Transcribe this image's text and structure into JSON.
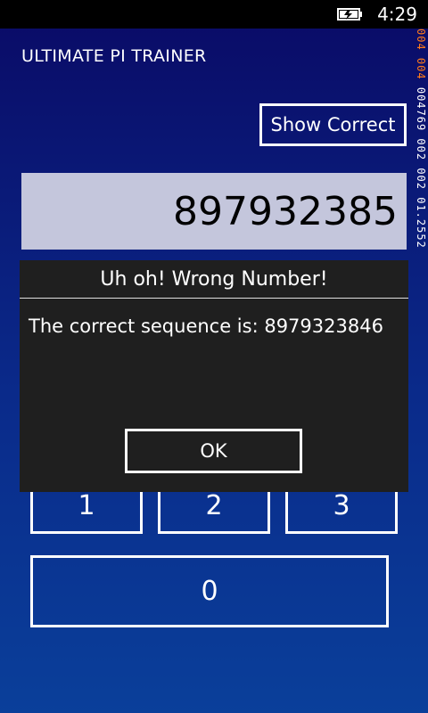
{
  "status_bar": {
    "time": "4:29",
    "battery_icon": "battery-charging-icon"
  },
  "app": {
    "title": "ULTIMATE PI TRAINER"
  },
  "toolbar": {
    "show_correct_label": "Show Correct"
  },
  "display": {
    "value": "897932385"
  },
  "debug_overlay": {
    "line1": "004",
    "line2": "004",
    "line3": "004769 002 002 01.2552"
  },
  "keypad": {
    "keys": [
      "1",
      "2",
      "3",
      "0"
    ]
  },
  "dialog": {
    "title": "Uh oh! Wrong Number!",
    "message": "The correct sequence is: 8979323846",
    "ok_label": "OK"
  }
}
